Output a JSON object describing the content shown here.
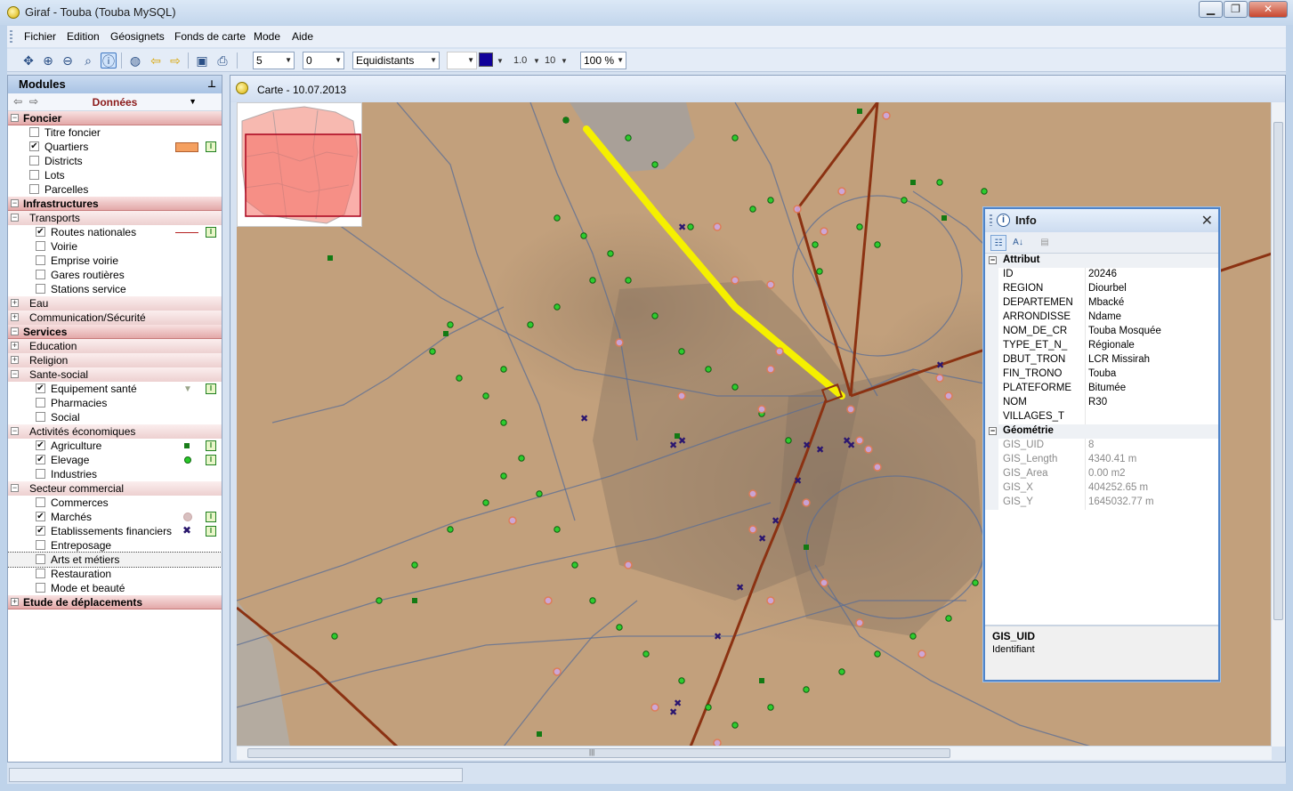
{
  "window": {
    "title": "Giraf - Touba  (Touba MySQL)",
    "min": "▁",
    "max": "❐",
    "close": "✕"
  },
  "menu": [
    "Fichier",
    "Edition",
    "Géosignets",
    "Fonds de carte",
    "Mode",
    "Aide"
  ],
  "toolbar": {
    "combo1": "5",
    "combo2": "0",
    "combo3": "Equidistants",
    "line_width": "1.0",
    "font_size": "10",
    "zoom": "100 %",
    "fill_color": "#10009a"
  },
  "modules": {
    "title": "Modules",
    "selector": "Données",
    "tree": [
      {
        "kind": "top",
        "label": "Foncier",
        "exp": "−"
      },
      {
        "kind": "item",
        "label": "Titre foncier",
        "checked": false,
        "indent": 1
      },
      {
        "kind": "item",
        "label": "Quartiers",
        "checked": true,
        "indent": 1,
        "legend": "rect",
        "info": true
      },
      {
        "kind": "item",
        "label": "Districts",
        "checked": false,
        "indent": 1
      },
      {
        "kind": "item",
        "label": "Lots",
        "checked": false,
        "indent": 1
      },
      {
        "kind": "item",
        "label": "Parcelles",
        "checked": false,
        "indent": 1
      },
      {
        "kind": "top",
        "label": "Infrastructures",
        "exp": "−"
      },
      {
        "kind": "sub",
        "label": "Transports",
        "exp": "−"
      },
      {
        "kind": "item",
        "label": "Routes nationales",
        "checked": true,
        "indent": 2,
        "legend": "line",
        "info": true
      },
      {
        "kind": "item",
        "label": "Voirie",
        "checked": false,
        "indent": 2
      },
      {
        "kind": "item",
        "label": "Emprise voirie",
        "checked": false,
        "indent": 2
      },
      {
        "kind": "item",
        "label": "Gares routières",
        "checked": false,
        "indent": 2
      },
      {
        "kind": "item",
        "label": "Stations service",
        "checked": false,
        "indent": 2
      },
      {
        "kind": "sub",
        "label": "Eau",
        "exp": "+"
      },
      {
        "kind": "sub",
        "label": "Communication/Sécurité",
        "exp": "+"
      },
      {
        "kind": "top",
        "label": "Services",
        "exp": "−"
      },
      {
        "kind": "sub",
        "label": "Education",
        "exp": "+"
      },
      {
        "kind": "sub",
        "label": "Religion",
        "exp": "+"
      },
      {
        "kind": "sub",
        "label": "Sante-social",
        "exp": "−"
      },
      {
        "kind": "item",
        "label": "Equipement santé",
        "checked": true,
        "indent": 2,
        "legend": "tri",
        "info": true
      },
      {
        "kind": "item",
        "label": "Pharmacies",
        "checked": false,
        "indent": 2
      },
      {
        "kind": "item",
        "label": "Social",
        "checked": false,
        "indent": 2
      },
      {
        "kind": "sub",
        "label": "Activités économiques",
        "exp": "−"
      },
      {
        "kind": "item",
        "label": "Agriculture",
        "checked": true,
        "indent": 2,
        "legend": "sq",
        "info": true
      },
      {
        "kind": "item",
        "label": "Elevage",
        "checked": true,
        "indent": 2,
        "legend": "dot",
        "info": true
      },
      {
        "kind": "item",
        "label": "Industries",
        "checked": false,
        "indent": 2
      },
      {
        "kind": "sub",
        "label": "Secteur commercial",
        "exp": "−"
      },
      {
        "kind": "item",
        "label": "Commerces",
        "checked": false,
        "indent": 2
      },
      {
        "kind": "item",
        "label": "Marchés",
        "checked": true,
        "indent": 2,
        "legend": "mdot",
        "info": true
      },
      {
        "kind": "item",
        "label": "Etablissements financiers",
        "checked": true,
        "indent": 2,
        "legend": "cross",
        "info": true
      },
      {
        "kind": "item",
        "label": "Entreposage",
        "checked": false,
        "indent": 2
      },
      {
        "kind": "item",
        "label": "Arts et métiers",
        "checked": false,
        "indent": 2,
        "selected": true
      },
      {
        "kind": "item",
        "label": "Restauration",
        "checked": false,
        "indent": 2
      },
      {
        "kind": "item",
        "label": "Mode et beauté",
        "checked": false,
        "indent": 2
      },
      {
        "kind": "top",
        "label": "Etude de déplacements",
        "exp": "+"
      }
    ]
  },
  "map": {
    "tab_title": "Carte - 10.07.2013",
    "colors": {
      "road": "#8b3212",
      "highlight": "#f5f000",
      "quartier": "#f08070",
      "elevage": "#2ecc2e",
      "agriculture": "#137a13",
      "marche": "#cfa7e0",
      "finance": "#2a1670"
    }
  },
  "info": {
    "title": "Info",
    "sections": [
      {
        "name": "Attribut",
        "readonly": false,
        "rows": [
          [
            "ID",
            "20246"
          ],
          [
            "REGION",
            "Diourbel"
          ],
          [
            "DEPARTEMEN",
            "Mbacké"
          ],
          [
            "ARRONDISSE",
            "Ndame"
          ],
          [
            "NOM_DE_CR",
            "Touba Mosquée"
          ],
          [
            "TYPE_ET_N_",
            "Régionale"
          ],
          [
            "DBUT_TRON",
            "LCR Missirah"
          ],
          [
            "FIN_TRONO",
            "Touba"
          ],
          [
            "PLATEFORME",
            "Bitumée"
          ],
          [
            "NOM",
            "R30"
          ],
          [
            "VILLAGES_T",
            ""
          ]
        ]
      },
      {
        "name": "Géométrie",
        "readonly": true,
        "rows": [
          [
            "GIS_UID",
            "8"
          ],
          [
            "GIS_Length",
            "4340.41 m"
          ],
          [
            "GIS_Area",
            "0.00 m2"
          ],
          [
            "GIS_X",
            "404252.65 m"
          ],
          [
            "GIS_Y",
            "1645032.77 m"
          ]
        ]
      }
    ],
    "desc_title": "GIS_UID",
    "desc_text": "Identifiant"
  }
}
